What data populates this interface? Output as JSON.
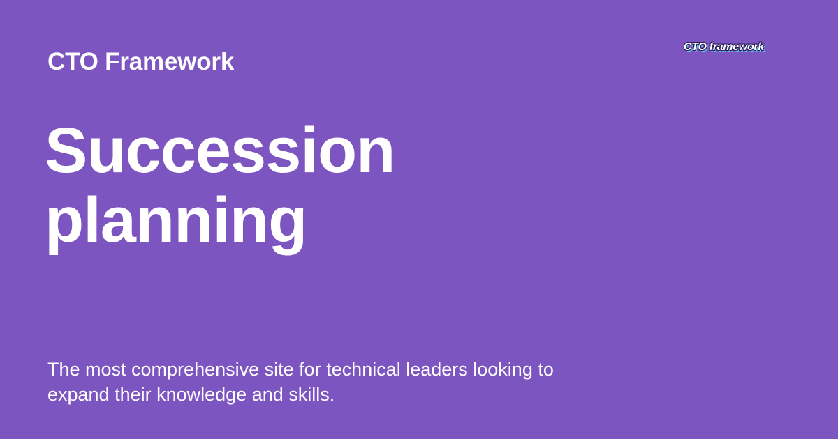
{
  "site": {
    "name": "CTO Framework",
    "logo_text": "CTO framework"
  },
  "page": {
    "title_line_1": "Succession",
    "title_line_2": "planning",
    "tagline": "The most comprehensive site for technical leaders looking to expand their knowledge and skills."
  },
  "colors": {
    "background": "#7d55c0",
    "text": "#ffffff",
    "logo_outline": "#2a1a5c",
    "logo_accent": "#4fd2e8"
  }
}
